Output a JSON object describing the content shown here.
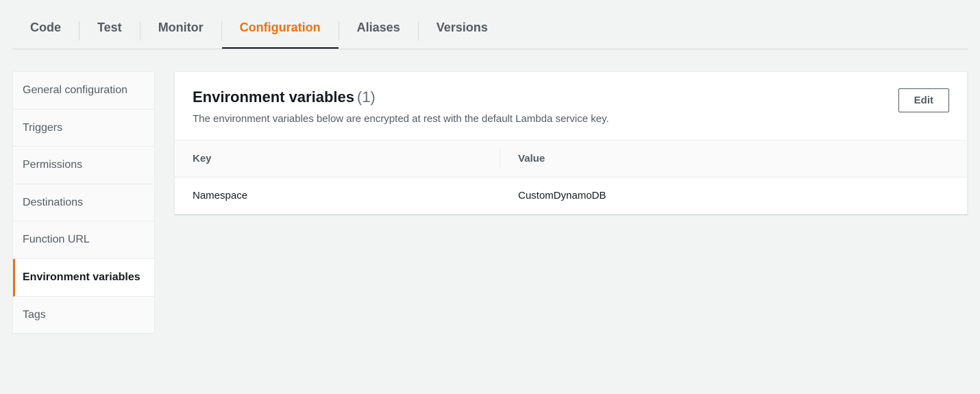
{
  "tabs": [
    {
      "label": "Code",
      "active": false
    },
    {
      "label": "Test",
      "active": false
    },
    {
      "label": "Monitor",
      "active": false
    },
    {
      "label": "Configuration",
      "active": true
    },
    {
      "label": "Aliases",
      "active": false
    },
    {
      "label": "Versions",
      "active": false
    }
  ],
  "sidebar": {
    "items": [
      {
        "label": "General configuration",
        "active": false
      },
      {
        "label": "Triggers",
        "active": false
      },
      {
        "label": "Permissions",
        "active": false
      },
      {
        "label": "Destinations",
        "active": false
      },
      {
        "label": "Function URL",
        "active": false
      },
      {
        "label": "Environment variables",
        "active": true
      },
      {
        "label": "Tags",
        "active": false
      }
    ]
  },
  "panel": {
    "title": "Environment variables",
    "count": "(1)",
    "description": "The environment variables below are encrypted at rest with the default Lambda service key.",
    "edit_label": "Edit"
  },
  "table": {
    "headers": {
      "key": "Key",
      "value": "Value"
    },
    "rows": [
      {
        "key": "Namespace",
        "value": "CustomDynamoDB"
      }
    ]
  }
}
